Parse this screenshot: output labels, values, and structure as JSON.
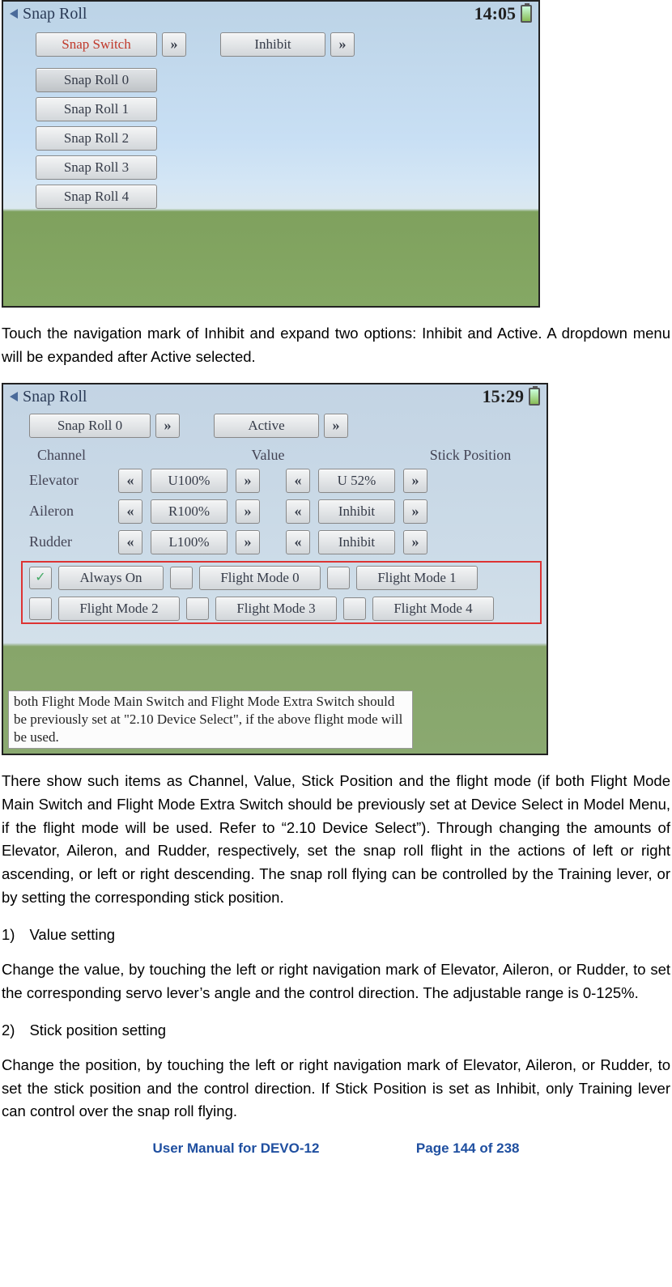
{
  "screens": {
    "s1": {
      "title": "Snap Roll",
      "time": "14:05",
      "top_left_btn": "Snap Switch",
      "top_right_btn": "Inhibit",
      "list": [
        "Snap Roll 0",
        "Snap Roll 1",
        "Snap Roll 2",
        "Snap Roll 3",
        "Snap Roll 4"
      ]
    },
    "s2": {
      "title": "Snap Roll",
      "time": "15:29",
      "top_left_btn": "Snap Roll 0",
      "top_right_btn": "Active",
      "headers": {
        "c1": "Channel",
        "c2": "Value",
        "c3": "Stick Position"
      },
      "rows": [
        {
          "ch": "Elevator",
          "val": "U100%",
          "pos": "U 52%"
        },
        {
          "ch": "Aileron",
          "val": "R100%",
          "pos": "Inhibit"
        },
        {
          "ch": "Rudder",
          "val": "L100%",
          "pos": "Inhibit"
        }
      ],
      "modes_row1": [
        "Always On",
        "Flight Mode 0",
        "Flight Mode 1"
      ],
      "modes_row2": [
        "Flight Mode 2",
        "Flight Mode 3",
        "Flight Mode 4"
      ],
      "note": "both Flight Mode Main Switch and Flight Mode Extra Switch should be previously set at \"2.10 Device Select\", if the above flight mode will be used."
    }
  },
  "glyphs": {
    "left": "«",
    "right": "»",
    "check": "✓"
  },
  "text": {
    "p1": "Touch the navigation mark of Inhibit and expand two options: Inhibit and Active. A dropdown menu will be expanded after Active selected.",
    "p2": "There show such items as Channel, Value, Stick Position and the flight mode (if both Flight Mode Main Switch and Flight Mode Extra Switch should be previously set at Device Select in Model Menu, if the flight mode will be used. Refer to “2.10 Device Select”). Through changing the amounts of Elevator, Aileron, and Rudder, respectively, set the snap roll flight in the actions of left or right ascending, or left or right descending. The snap roll flying can be controlled by the Training lever, or by setting the corresponding stick position.",
    "h1_num": "1)",
    "h1": "Value setting",
    "p3": "Change the value, by touching the left or right navigation mark of Elevator, Aileron, or Rudder, to set the corresponding servo lever’s angle and the control direction. The adjustable range is 0-125%.",
    "h2_num": "2)",
    "h2": "Stick position setting",
    "p4": "Change the position, by touching the left or right navigation mark of Elevator, Aileron, or Rudder, to set the stick position and the control direction. If Stick Position is set as Inhibit, only Training lever can control over the snap roll flying."
  },
  "footer": {
    "left": "User Manual for DEVO-12",
    "right": "Page 144 of 238"
  }
}
